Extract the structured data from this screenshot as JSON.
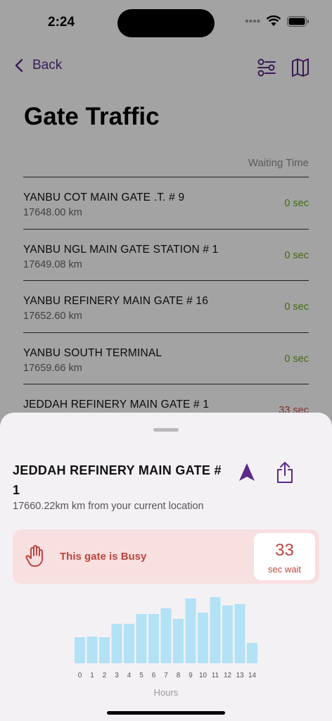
{
  "status": {
    "time": "2:24"
  },
  "nav": {
    "back_label": "Back"
  },
  "page": {
    "title": "Gate Traffic",
    "column_header": "Waiting Time"
  },
  "gates": [
    {
      "name": "YANBU COT MAIN GATE .T. # 9",
      "distance": "17648.00 km",
      "wait": "0 sec",
      "status": "free"
    },
    {
      "name": "YANBU NGL MAIN GATE STATION #  1",
      "distance": "17649.08 km",
      "wait": "0 sec",
      "status": "free"
    },
    {
      "name": "YANBU REFINERY MAIN GATE #  16",
      "distance": "17652.60 km",
      "wait": "0 sec",
      "status": "free"
    },
    {
      "name": "YANBU SOUTH TERMINAL",
      "distance": "17659.66 km",
      "wait": "0 sec",
      "status": "free"
    },
    {
      "name": "JEDDAH REFINERY MAIN GATE # 1",
      "distance": "",
      "wait": "33 sec",
      "status": "busy"
    }
  ],
  "colors": {
    "accent": "#5b2a86",
    "free": "#6aaa1e",
    "busy": "#c4584a",
    "bar": "#b3e1f5"
  },
  "sheet": {
    "title": "JEDDAH REFINERY MAIN GATE # 1",
    "subtitle": "17660.22km km from your current location",
    "busy_text": "This gate is Busy",
    "wait_value": "33",
    "wait_unit": "sec wait"
  },
  "chart_data": {
    "type": "bar",
    "categories": [
      "0",
      "1",
      "2",
      "3",
      "4",
      "5",
      "6",
      "7",
      "8",
      "9",
      "10",
      "11",
      "12",
      "13",
      "14"
    ],
    "values": [
      37,
      38,
      37,
      56,
      56,
      70,
      70,
      78,
      63,
      92,
      72,
      94,
      82,
      84,
      29
    ],
    "xlabel": "Hours",
    "ylabel": "",
    "ylim": [
      0,
      100
    ],
    "grid": false
  }
}
